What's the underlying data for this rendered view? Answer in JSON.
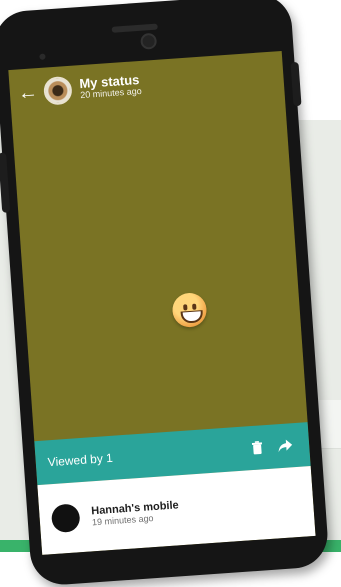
{
  "status_header": {
    "title": "My status",
    "subtitle": "20 minutes ago"
  },
  "status_content": {
    "emoji": "grinning-face"
  },
  "viewed_bar": {
    "label": "Viewed by 1",
    "actions": [
      "delete-icon",
      "share-icon"
    ]
  },
  "viewer": {
    "name": "Hannah's mobile",
    "time": "19 minutes ago"
  },
  "colors": {
    "status_background": "#7a7324",
    "accent_teal": "#2aa49a",
    "phone_body": "#151515"
  }
}
